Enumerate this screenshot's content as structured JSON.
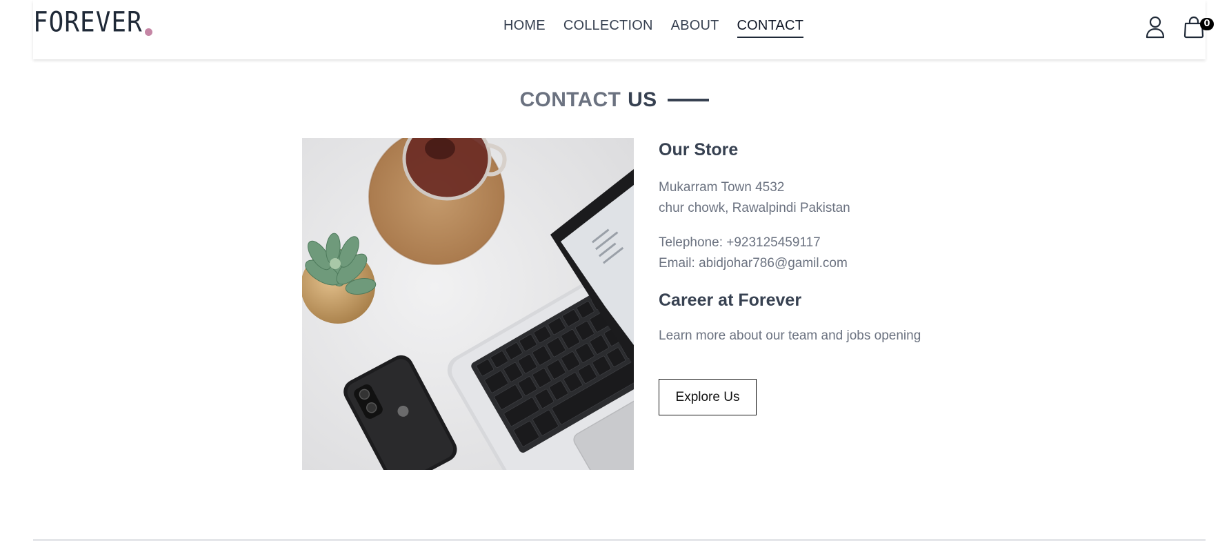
{
  "brand": {
    "name": "FOREVER",
    "dot_color": "#c586a5"
  },
  "nav": {
    "items": [
      {
        "label": "HOME",
        "active": false
      },
      {
        "label": "COLLECTION",
        "active": false
      },
      {
        "label": "ABOUT",
        "active": false
      },
      {
        "label": "CONTACT",
        "active": true
      }
    ]
  },
  "header_icons": {
    "profile": "user-icon",
    "cart": "shopping-bag-icon",
    "cart_count": "0"
  },
  "page": {
    "title_light": "CONTACT",
    "title_dark": "US"
  },
  "image": {
    "description_icon": "laptop-desk-photo"
  },
  "store": {
    "heading": "Our Store",
    "address_line1": "Mukarram Town 4532",
    "address_line2": "chur chowk, Rawalpindi Pakistan",
    "telephone": "Telephone: +923125459117",
    "email": "Email: abidjohar786@gamil.com"
  },
  "career": {
    "heading": "Career at Forever",
    "text": "Learn more about our team and jobs opening",
    "button_label": "Explore Us"
  },
  "colors": {
    "text_dark": "#374151",
    "text_muted": "#6b7280",
    "accent_dot": "#c586a5"
  }
}
